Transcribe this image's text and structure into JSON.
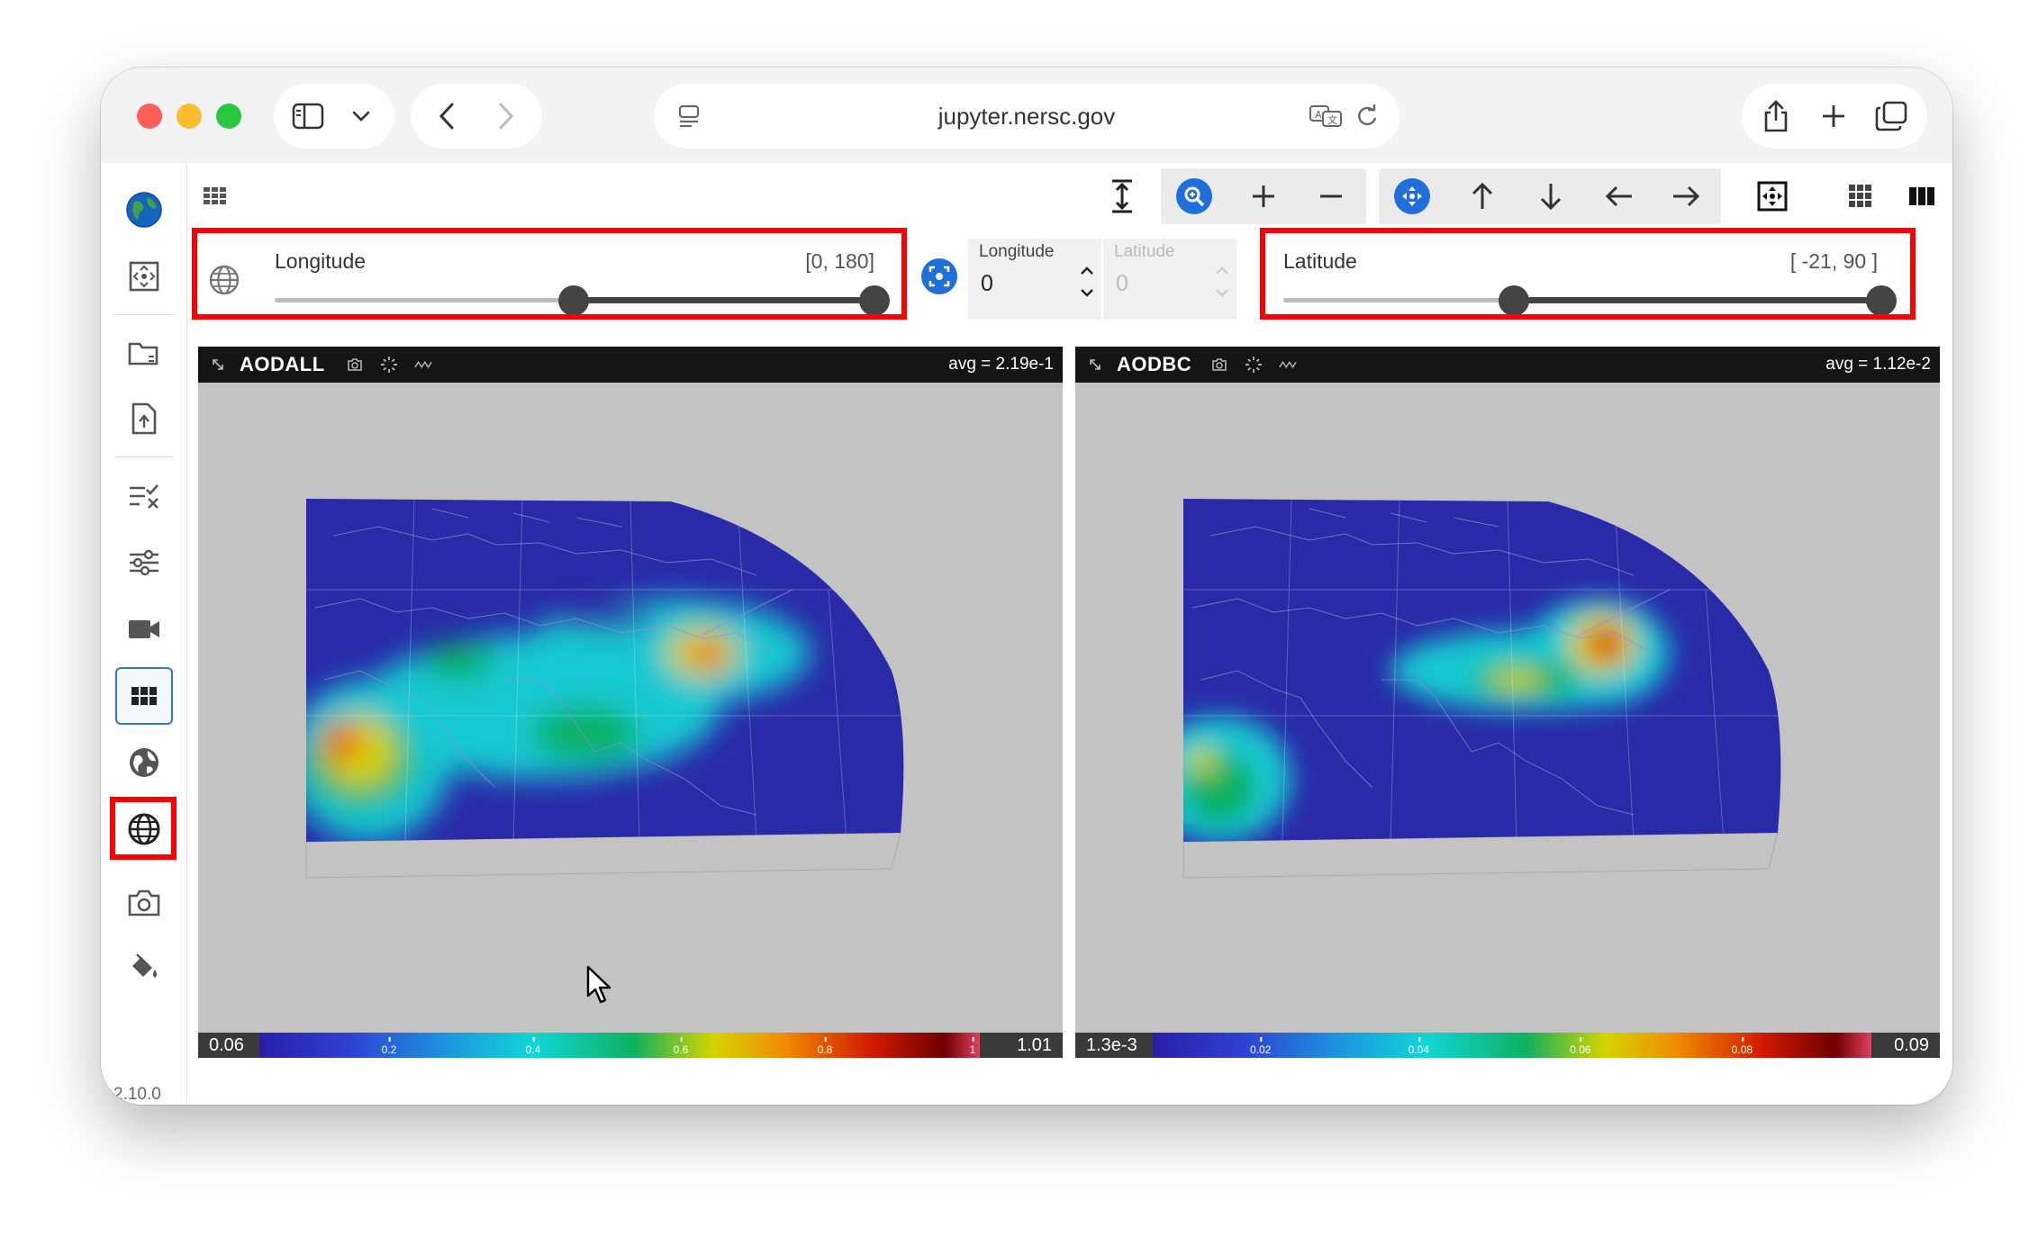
{
  "browser": {
    "url": "jupyter.nersc.gov"
  },
  "version": "2.10.0",
  "sliders": {
    "longitude": {
      "label": "Longitude",
      "range": "[0, 180]",
      "low": 0,
      "high": 180
    },
    "latitude": {
      "label": "Latitude",
      "range": "[ -21, 90 ]",
      "low": -21,
      "high": 90
    }
  },
  "coords": {
    "longitude": {
      "label": "Longitude",
      "value": "0"
    },
    "latitude": {
      "label": "Latitude",
      "value": "0"
    }
  },
  "panels": [
    {
      "title": "AODALL",
      "avg": "avg = 2.19e-1",
      "cb_min": "0.06",
      "cb_max": "1.01",
      "ticks": [
        "0.2",
        "0.4",
        "0.6",
        "0.8",
        "1"
      ]
    },
    {
      "title": "AODBC",
      "avg": "avg = 1.12e-2",
      "cb_min": "1.3e-3",
      "cb_max": "0.09",
      "ticks": [
        "0.02",
        "0.04",
        "0.06",
        "0.08"
      ]
    }
  ],
  "colors": {
    "accent": "#1e6fd9",
    "highlight": "#ff0000",
    "map_base": "#2a2aa8"
  }
}
